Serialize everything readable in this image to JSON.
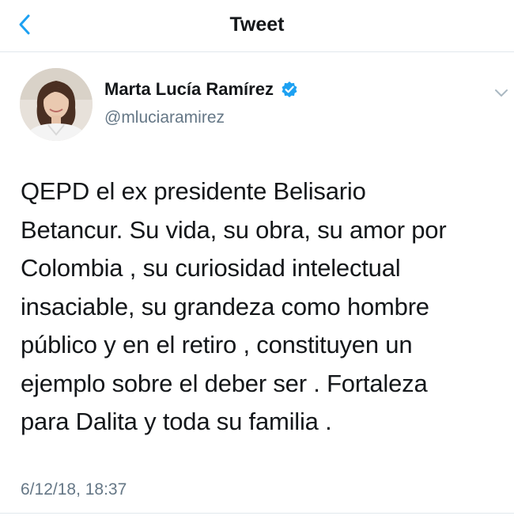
{
  "nav": {
    "title": "Tweet",
    "back_icon": "chevron-left-icon"
  },
  "author": {
    "name": "Marta Lucía Ramírez",
    "handle": "@mluciaramirez",
    "verified_icon": "verified-badge-icon"
  },
  "tweet": {
    "lines": [
      "QEPD el ex presidente Belisario",
      "Betancur. Su vida, su obra, su amor por",
      "Colombia , su curiosidad intelectual",
      "insaciable, su grandeza como hombre",
      "público y en el retiro , constituyen un",
      "ejemplo sobre el deber ser . Fortaleza",
      "para Dalita y toda su familia ."
    ],
    "timestamp": "6/12/18, 18:37"
  },
  "colors": {
    "accent": "#1da1f2",
    "text": "#14171a",
    "secondary_text": "#657786",
    "divider": "#e1e8ed"
  }
}
